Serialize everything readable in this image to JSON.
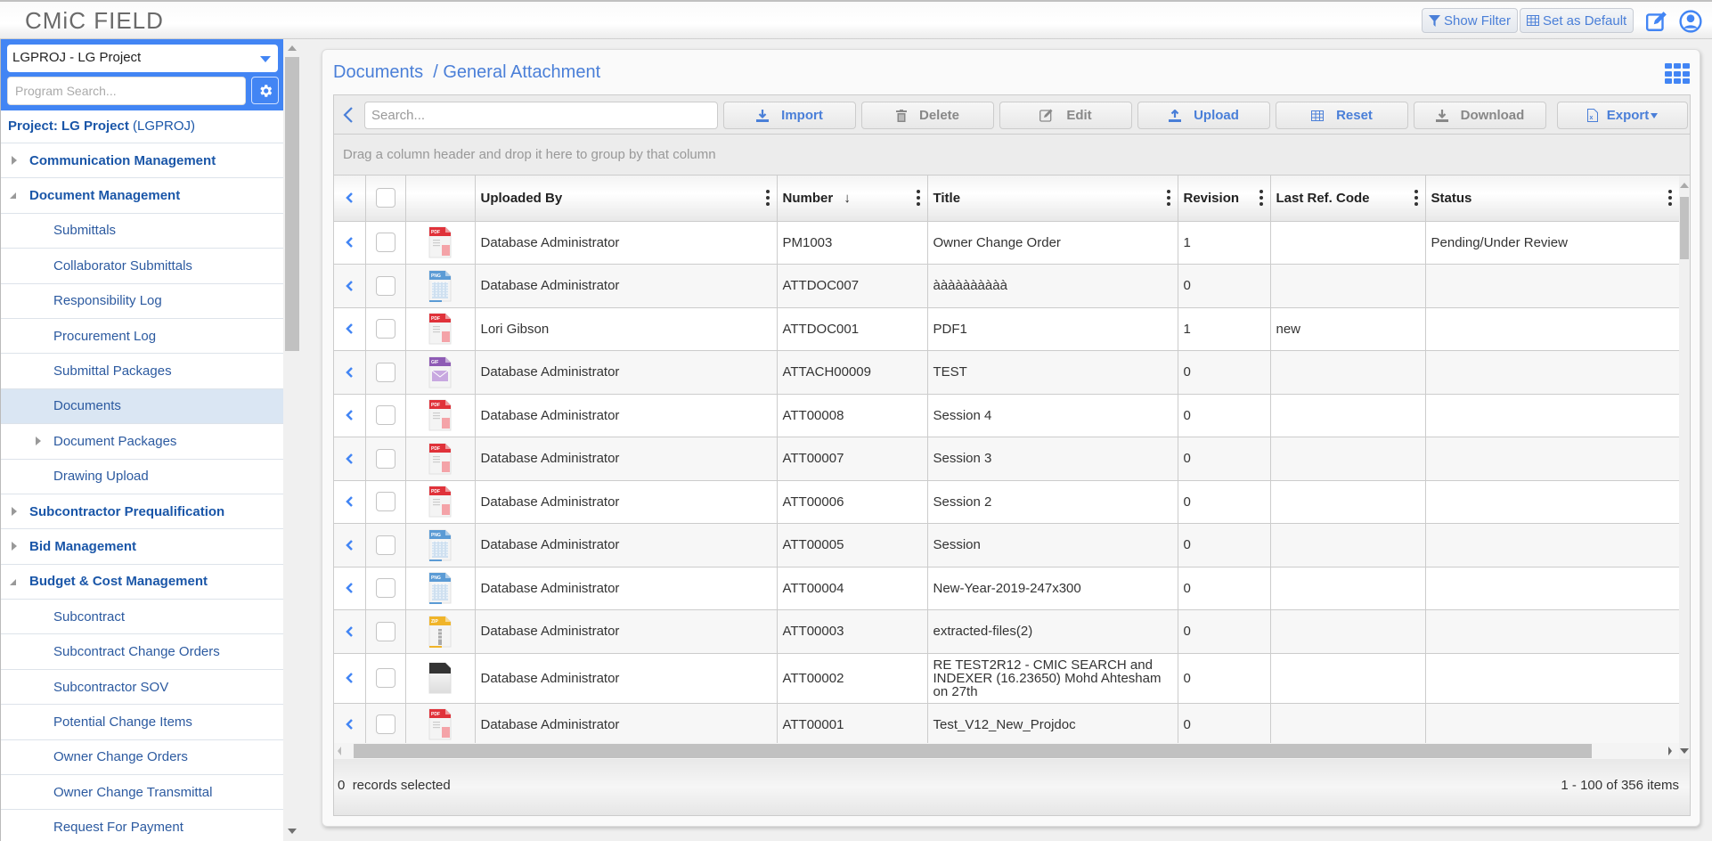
{
  "app": {
    "logo": "CMiC FIELD",
    "show_filter_label": "Show Filter",
    "set_default_label": "Set as Default"
  },
  "sidebar": {
    "project_select": "LGPROJ - LG Project",
    "program_search_placeholder": "Program Search...",
    "project_label": "Project: LG Project",
    "project_code": "(LGPROJ)",
    "items": [
      {
        "label": "Communication Management",
        "type": "group",
        "expanded": false
      },
      {
        "label": "Document Management",
        "type": "group",
        "expanded": true
      },
      {
        "label": "Submittals",
        "type": "child"
      },
      {
        "label": "Collaborator Submittals",
        "type": "child"
      },
      {
        "label": "Responsibility Log",
        "type": "child"
      },
      {
        "label": "Procurement Log",
        "type": "child"
      },
      {
        "label": "Submittal Packages",
        "type": "child"
      },
      {
        "label": "Documents",
        "type": "child",
        "active": true
      },
      {
        "label": "Document Packages",
        "type": "child",
        "expandable": true
      },
      {
        "label": "Drawing Upload",
        "type": "child"
      },
      {
        "label": "Subcontractor Prequalification",
        "type": "group",
        "expanded": false
      },
      {
        "label": "Bid Management",
        "type": "group",
        "expanded": false
      },
      {
        "label": "Budget & Cost Management",
        "type": "group",
        "expanded": true
      },
      {
        "label": "Subcontract",
        "type": "child"
      },
      {
        "label": "Subcontract Change Orders",
        "type": "child"
      },
      {
        "label": "Subcontractor SOV",
        "type": "child"
      },
      {
        "label": "Potential Change Items",
        "type": "child"
      },
      {
        "label": "Owner Change Orders",
        "type": "child"
      },
      {
        "label": "Owner Change Transmittal",
        "type": "child"
      },
      {
        "label": "Request For Payment",
        "type": "child"
      }
    ]
  },
  "main": {
    "breadcrumb": "Documents  / General Attachment",
    "search_placeholder": "Search...",
    "toolbar": {
      "import": "Import",
      "delete": "Delete",
      "edit": "Edit",
      "upload": "Upload",
      "reset": "Reset",
      "download": "Download",
      "export": "Export"
    },
    "group_hint": "Drag a column header and drop it here to group by that column",
    "columns": [
      "Uploaded By",
      "Number",
      "Title",
      "Revision",
      "Last Ref. Code",
      "Status"
    ],
    "sort_column": "Number",
    "sort_dir": "desc",
    "rows": [
      {
        "type": "pdf",
        "uploaded_by": "Database Administrator",
        "number": "PM1003",
        "title": "Owner Change Order",
        "revision": "1",
        "last_ref": "",
        "status": "Pending/Under Review"
      },
      {
        "type": "png",
        "uploaded_by": "Database Administrator",
        "number": "ATTDOC007",
        "title": "àààààààààà",
        "revision": "0",
        "last_ref": "",
        "status": ""
      },
      {
        "type": "pdf",
        "uploaded_by": "Lori Gibson",
        "number": "ATTDOC001",
        "title": "PDF1",
        "revision": "1",
        "last_ref": "new",
        "status": ""
      },
      {
        "type": "gif",
        "uploaded_by": "Database Administrator",
        "number": "ATTACH00009",
        "title": "TEST",
        "revision": "0",
        "last_ref": "",
        "status": ""
      },
      {
        "type": "pdf",
        "uploaded_by": "Database Administrator",
        "number": "ATT00008",
        "title": "Session 4",
        "revision": "0",
        "last_ref": "",
        "status": ""
      },
      {
        "type": "pdf",
        "uploaded_by": "Database Administrator",
        "number": "ATT00007",
        "title": "Session 3",
        "revision": "0",
        "last_ref": "",
        "status": ""
      },
      {
        "type": "pdf",
        "uploaded_by": "Database Administrator",
        "number": "ATT00006",
        "title": "Session 2",
        "revision": "0",
        "last_ref": "",
        "status": ""
      },
      {
        "type": "png",
        "uploaded_by": "Database Administrator",
        "number": "ATT00005",
        "title": "Session",
        "revision": "0",
        "last_ref": "",
        "status": ""
      },
      {
        "type": "png",
        "uploaded_by": "Database Administrator",
        "number": "ATT00004",
        "title": "New-Year-2019-247x300",
        "revision": "0",
        "last_ref": "",
        "status": ""
      },
      {
        "type": "zip",
        "uploaded_by": "Database Administrator",
        "number": "ATT00003",
        "title": "extracted-files(2)",
        "revision": "0",
        "last_ref": "",
        "status": ""
      },
      {
        "type": "generic",
        "uploaded_by": "Database Administrator",
        "number": "ATT00002",
        "title": "RE TEST2R12 - CMIC SEARCH and INDEXER (16.23650) Mohd Ahtesham on 27th",
        "revision": "0",
        "last_ref": "",
        "status": ""
      },
      {
        "type": "pdf",
        "uploaded_by": "Database Administrator",
        "number": "ATT00001",
        "title": "Test_V12_New_Projdoc",
        "revision": "0",
        "last_ref": "",
        "status": ""
      },
      {
        "type": "pdf",
        "uploaded_by": "",
        "number": "",
        "title": "",
        "revision": "",
        "last_ref": "",
        "status": ""
      }
    ],
    "footer": {
      "selected_count": "0",
      "selected_label": "records selected",
      "paging": "1 - 100 of 356 items"
    }
  },
  "colors": {
    "accent": "#4285f4",
    "link": "#4a7fd8",
    "nav_text": "#1a56a8",
    "active_bg": "#dae6f3",
    "pdf": "#e0323a",
    "png": "#5b9bd5",
    "gif": "#8e5bb5",
    "zip": "#f0b429"
  }
}
